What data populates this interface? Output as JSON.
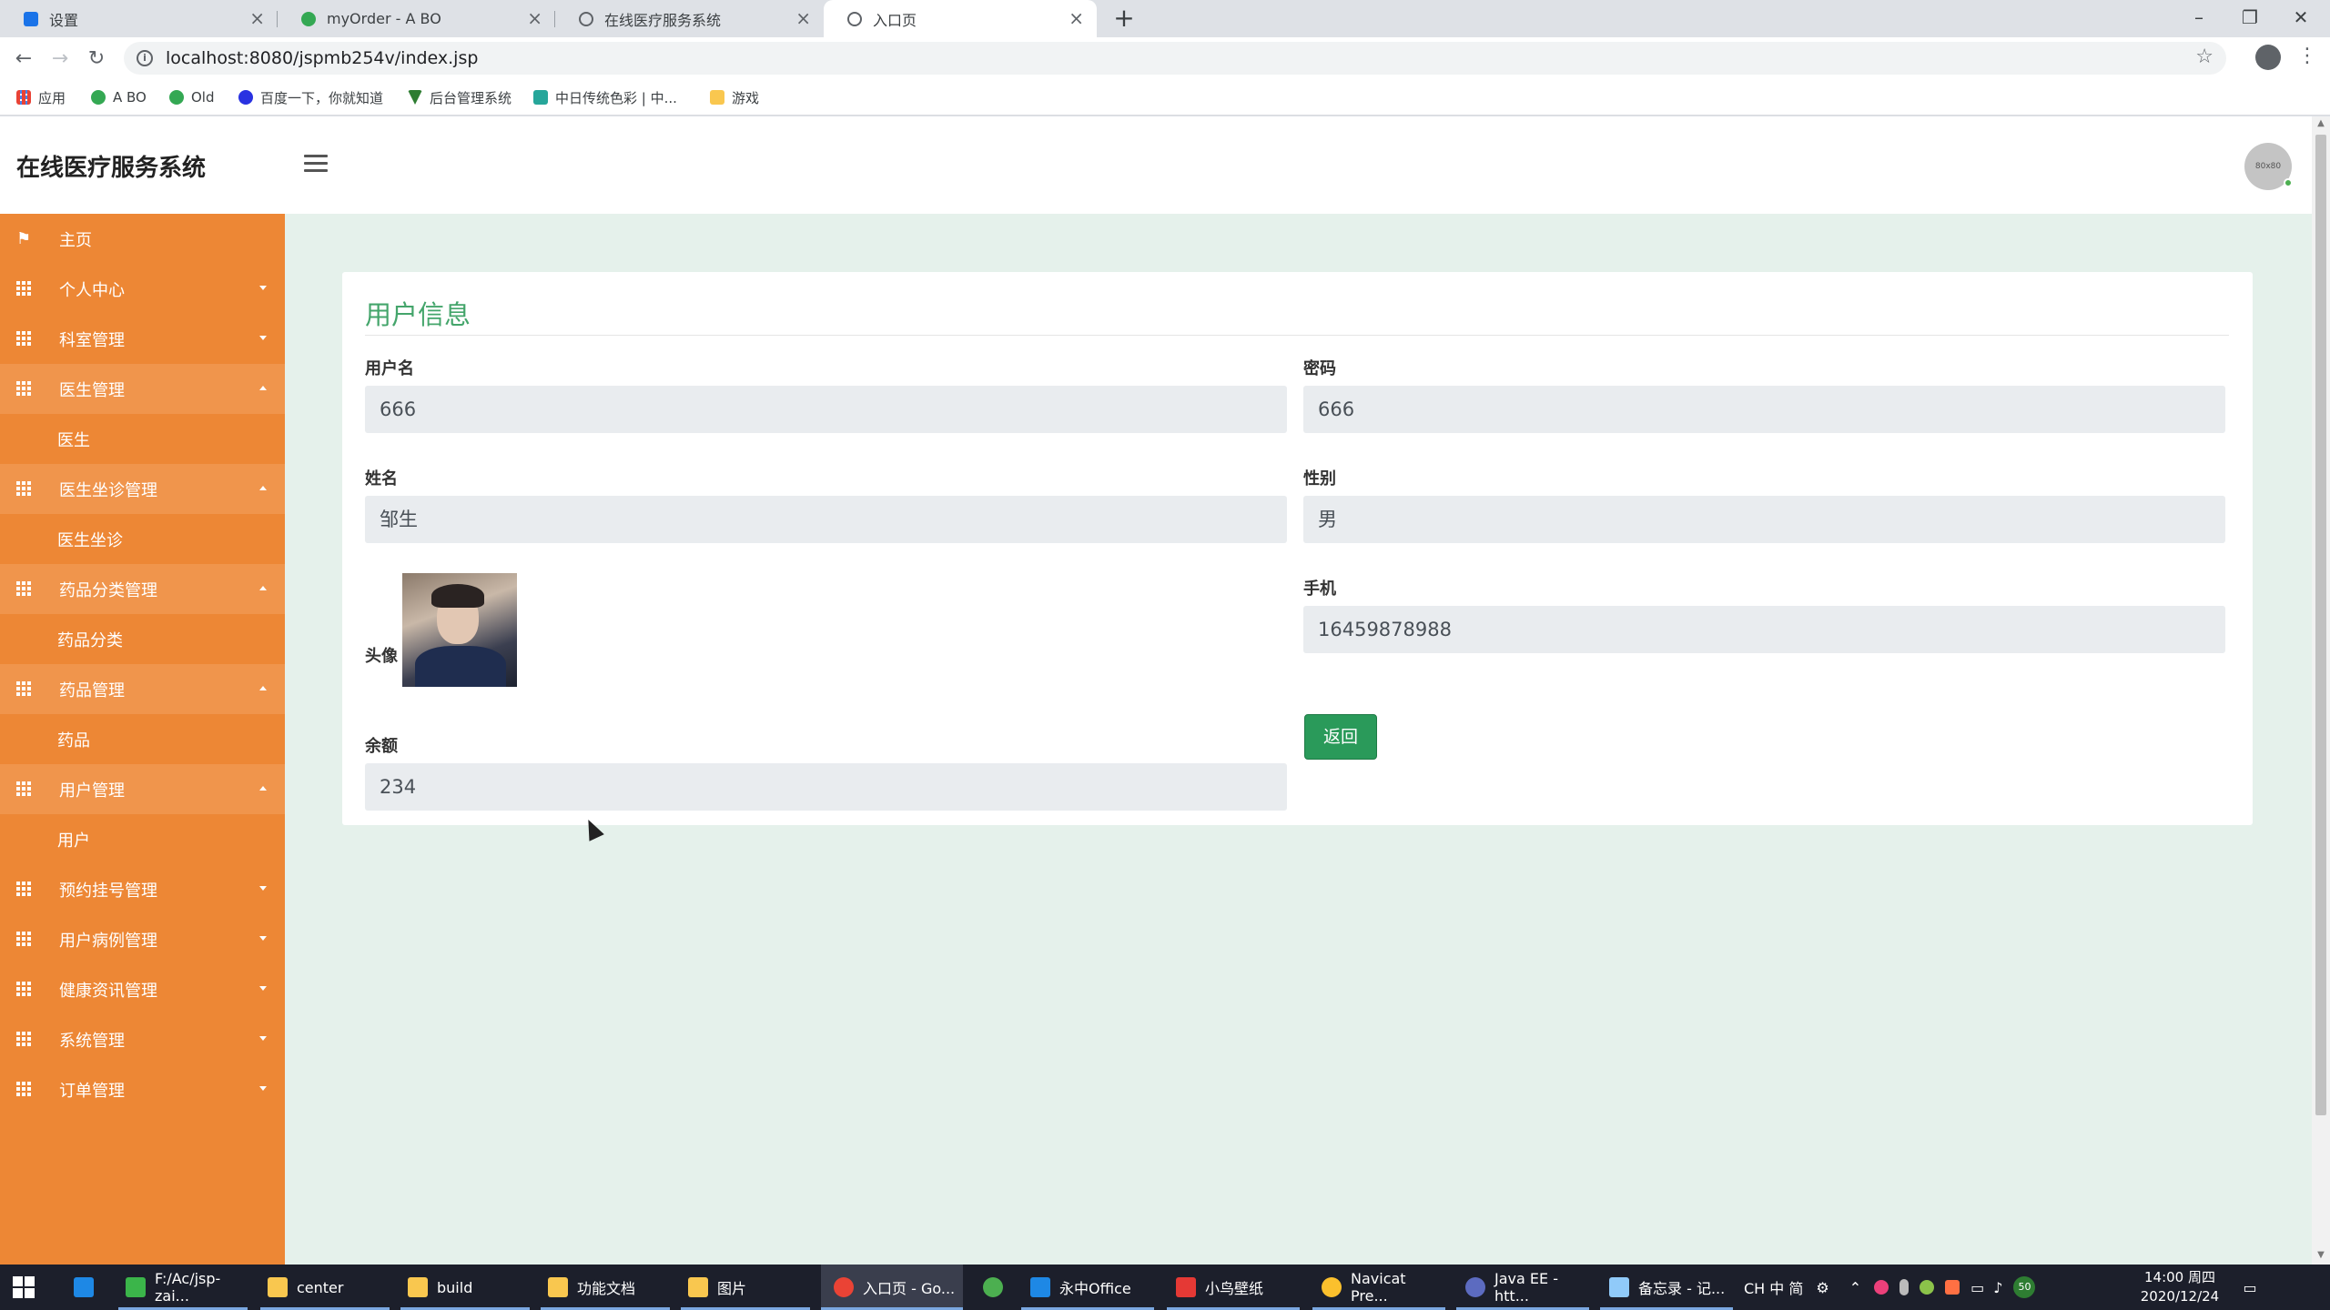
{
  "browser": {
    "tabs": [
      {
        "title": "设置",
        "icon": "gear-icon",
        "color": "#1a73e8"
      },
      {
        "title": "myOrder - A BO",
        "icon": "leaf-icon",
        "color": "#34a853"
      },
      {
        "title": "在线医疗服务系统",
        "icon": "globe-icon",
        "color": "#5f6368"
      },
      {
        "title": "入口页",
        "icon": "globe-icon",
        "color": "#5f6368",
        "active": true
      }
    ],
    "url": "localhost:8080/jspmb254v/index.jsp",
    "bookmarks": [
      {
        "label": "应用",
        "icon": "apps-grid-icon",
        "color": "#e94235"
      },
      {
        "label": "A BO",
        "icon": "leaf-icon",
        "color": "#34a853"
      },
      {
        "label": "Old",
        "icon": "leaf-icon",
        "color": "#34a853"
      },
      {
        "label": "百度一下，你就知道",
        "icon": "paw-icon",
        "color": "#2932e1"
      },
      {
        "label": "后台管理系统",
        "icon": "vue-icon",
        "color": "#2e7d32"
      },
      {
        "label": "中日传统色彩 | 中...",
        "icon": "color-icon",
        "color": "#26a69a"
      },
      {
        "label": "游戏",
        "icon": "folder-icon",
        "color": "#f9c74f"
      }
    ]
  },
  "app": {
    "brand": "在线医疗服务系统",
    "avatar_text": "80x80",
    "menu": [
      {
        "label": "主页",
        "icon": "flag-icon",
        "type": "item"
      },
      {
        "label": "个人中心",
        "icon": "grid-icon",
        "type": "group",
        "open": false
      },
      {
        "label": "科室管理",
        "icon": "grid-icon",
        "type": "group",
        "open": false
      },
      {
        "label": "医生管理",
        "icon": "grid-icon",
        "type": "group",
        "open": true
      },
      {
        "label": "医生",
        "type": "sub"
      },
      {
        "label": "医生坐诊管理",
        "icon": "grid-icon",
        "type": "group",
        "open": true
      },
      {
        "label": "医生坐诊",
        "type": "sub"
      },
      {
        "label": "药品分类管理",
        "icon": "grid-icon",
        "type": "group",
        "open": true
      },
      {
        "label": "药品分类",
        "type": "sub"
      },
      {
        "label": "药品管理",
        "icon": "grid-icon",
        "type": "group",
        "open": true
      },
      {
        "label": "药品",
        "type": "sub"
      },
      {
        "label": "用户管理",
        "icon": "grid-icon",
        "type": "group",
        "open": true
      },
      {
        "label": "用户",
        "type": "sub"
      },
      {
        "label": "预约挂号管理",
        "icon": "grid-icon",
        "type": "group",
        "open": false
      },
      {
        "label": "用户病例管理",
        "icon": "grid-icon",
        "type": "group",
        "open": false
      },
      {
        "label": "健康资讯管理",
        "icon": "grid-icon",
        "type": "group",
        "open": false
      },
      {
        "label": "系统管理",
        "icon": "grid-icon",
        "type": "group",
        "open": false
      },
      {
        "label": "订单管理",
        "icon": "grid-icon",
        "type": "group",
        "open": false
      }
    ],
    "form": {
      "title": "用户信息",
      "username_label": "用户名",
      "username": "666",
      "password_label": "密码",
      "password": "666",
      "name_label": "姓名",
      "name": "邹生",
      "gender_label": "性别",
      "gender": "男",
      "avatar_label": "头像",
      "phone_label": "手机",
      "phone": "16459878988",
      "balance_label": "余额",
      "balance": "234",
      "back_button": "返回"
    },
    "colors": {
      "sidebar": "#ed8735",
      "accent": "#44a56b",
      "button": "#2a9a5a"
    }
  },
  "taskbar": {
    "items": [
      {
        "label": "F:/Ac/jsp-zai...",
        "icon": "hbuilder-icon",
        "color": "#3bb54a"
      },
      {
        "label": "center",
        "icon": "folder-icon",
        "color": "#f9c74f"
      },
      {
        "label": "build",
        "icon": "folder-icon",
        "color": "#f9c74f"
      },
      {
        "label": "功能文档",
        "icon": "folder-icon",
        "color": "#f9c74f"
      },
      {
        "label": "图片",
        "icon": "folder-icon",
        "color": "#f9c74f"
      },
      {
        "label": "入口页 - Go...",
        "icon": "chrome-icon",
        "color": "#ea4335",
        "active": true
      },
      {
        "label": "",
        "icon": "app-icon",
        "color": "#4caf50"
      },
      {
        "label": "永中Office",
        "icon": "office-icon",
        "color": "#1e88e5"
      },
      {
        "label": "小鸟壁纸",
        "icon": "bird-icon",
        "color": "#e53935"
      },
      {
        "label": "Navicat Pre...",
        "icon": "navicat-icon",
        "color": "#fbc02d"
      },
      {
        "label": "Java EE - htt...",
        "icon": "eclipse-icon",
        "color": "#5c6bc0"
      },
      {
        "label": "备忘录 - 记...",
        "icon": "notepad-icon",
        "color": "#90caf9"
      }
    ],
    "tray": "CH 中 简",
    "battery": "50",
    "time": "14:00 周四",
    "date": "2020/12/24"
  }
}
